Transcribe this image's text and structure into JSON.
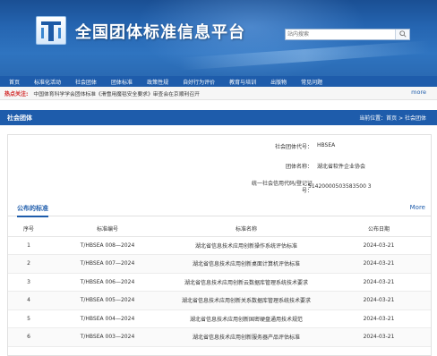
{
  "header": {
    "site_title": "全国团体标准信息平台",
    "search_placeholder": "站内搜索",
    "search_value": ""
  },
  "nav": {
    "items": [
      "首页",
      "标准化活动",
      "社会团体",
      "团体标准",
      "政策性规",
      "自好行为评价",
      "教育与培训",
      "出版物",
      "常见问题"
    ]
  },
  "hotbar": {
    "label": "热点关注:",
    "text": "中国体育科学学会团体标准《滑雪用魔毯安全要求》审查会在京顺利召开",
    "more": "more"
  },
  "section": {
    "title": "社会团体",
    "breadcrumb": "当前位置：首页 > 社会团体"
  },
  "org": {
    "code_label": "社会团体代号：",
    "code_value": "HBSEA",
    "name_label": "团体名称：",
    "name_value": "湖北省软件企业协会",
    "credit_label_1": "统一社会信用代码/登记证",
    "credit_label_2": "号：",
    "credit_value": "51420000503583500 3"
  },
  "tabs": {
    "active": "公布的标准",
    "more": "More"
  },
  "table": {
    "headers": [
      "序号",
      "标准编号",
      "标准名称",
      "公布日期"
    ],
    "rows": [
      {
        "no": "1",
        "code": "T/HBSEA 008—2024",
        "name": "湖北省信息技术应用创新操作系统评估标准",
        "date": "2024-03-21"
      },
      {
        "no": "2",
        "code": "T/HBSEA 007—2024",
        "name": "湖北省信息技术应用创新桌面计算机评估标准",
        "date": "2024-03-21"
      },
      {
        "no": "3",
        "code": "T/HBSEA 006—2024",
        "name": "湖北省信息技术应用创新云数据库管理系统技术要求",
        "date": "2024-03-21"
      },
      {
        "no": "4",
        "code": "T/HBSEA 005—2024",
        "name": "湖北省信息技术应用创新关系数据库管理系统技术要求",
        "date": "2024-03-21"
      },
      {
        "no": "5",
        "code": "T/HBSEA 004—2024",
        "name": "湖北省信息技术应用创新国密硬盘通用技术规范",
        "date": "2024-03-21"
      },
      {
        "no": "6",
        "code": "T/HBSEA 003—2024",
        "name": "湖北省信息技术应用创新服务器产品评估标准",
        "date": "2024-03-21"
      }
    ]
  }
}
